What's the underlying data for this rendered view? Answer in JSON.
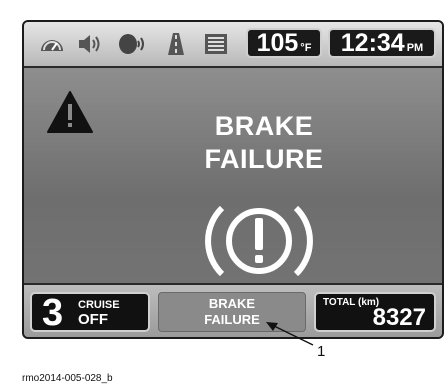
{
  "topbar": {
    "icons": [
      "speedometer-icon",
      "speaker-volume-icon",
      "voice-command-icon",
      "road-icon",
      "list-menu-icon"
    ],
    "temperature": "105",
    "temperature_unit": "°F",
    "time": "12:34",
    "time_period": "PM"
  },
  "alert": {
    "warning_icon": "warning-triangle-icon",
    "message_line1": "BRAKE",
    "message_line2": "FAILURE",
    "symbol": "brake-warning-icon"
  },
  "bottombar": {
    "cruise_number": "3",
    "cruise_label": "CRUISE",
    "cruise_state": "OFF",
    "status_line1": "BRAKE",
    "status_line2": "FAILURE",
    "total_label": "TOTAL (km)",
    "total_value": "8327"
  },
  "annotation": {
    "callout_number": "1",
    "figure_id": "rmo2014-005-028_b"
  },
  "colors": {
    "screen_bg": "#7a7a7a",
    "box_dark": "#111111",
    "text_light": "#ffffff"
  }
}
